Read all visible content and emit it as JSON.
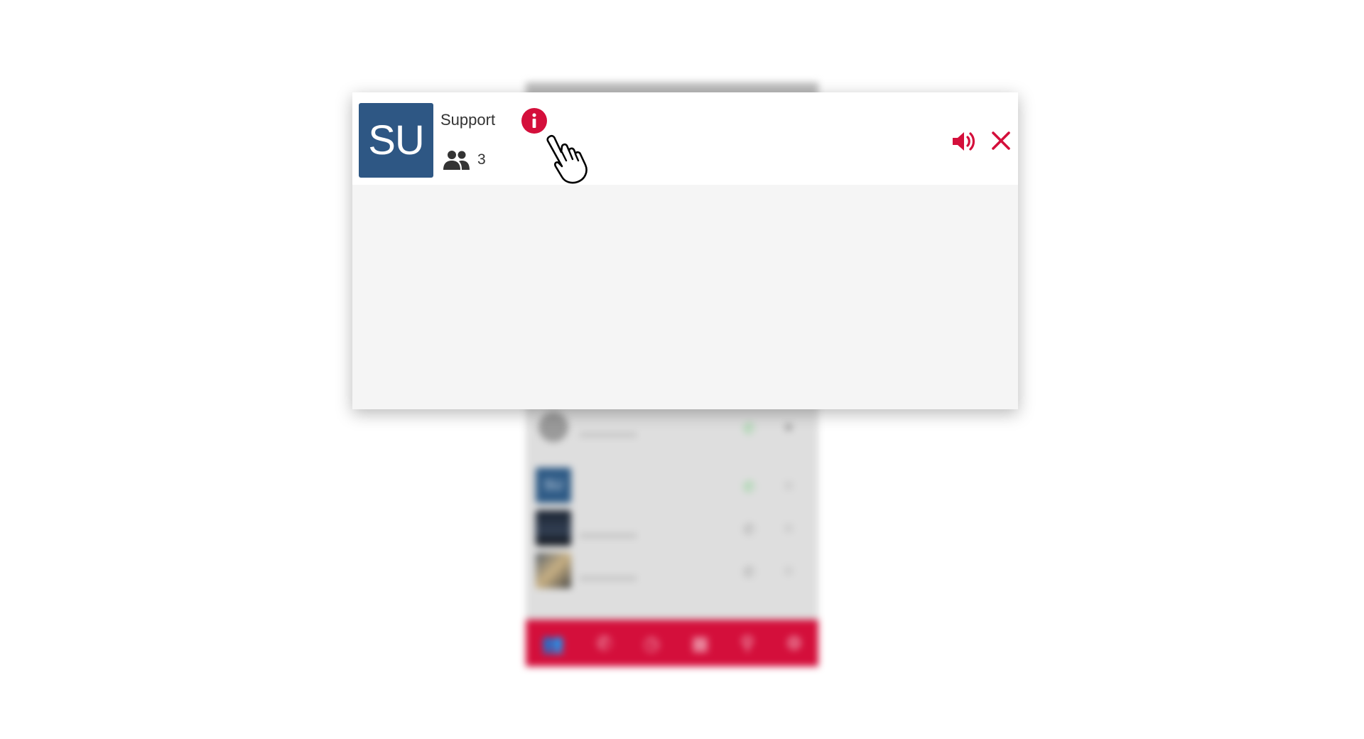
{
  "background_app": {
    "rows": [
      {
        "name": "",
        "avatar": "person"
      },
      {
        "separator": ""
      },
      {
        "name": "",
        "avatar_text": "SU"
      },
      {
        "name": "",
        "avatar": "dark"
      },
      {
        "name": "",
        "avatar": "road"
      }
    ],
    "tab_icons": [
      "contacts-icon",
      "phone-icon",
      "history-icon",
      "directory-icon",
      "search-icon",
      "settings-icon"
    ],
    "accent_color": "#d40f3b"
  },
  "card": {
    "avatar_initials": "SU",
    "avatar_color": "#2e5784",
    "group_name": "Support",
    "member_count": "3",
    "icons": {
      "members": "group-icon",
      "info": "info-icon",
      "sound": "speaker-icon",
      "close": "close-icon",
      "cursor": "hand-pointer-icon"
    },
    "accent_color": "#d40f3b"
  }
}
